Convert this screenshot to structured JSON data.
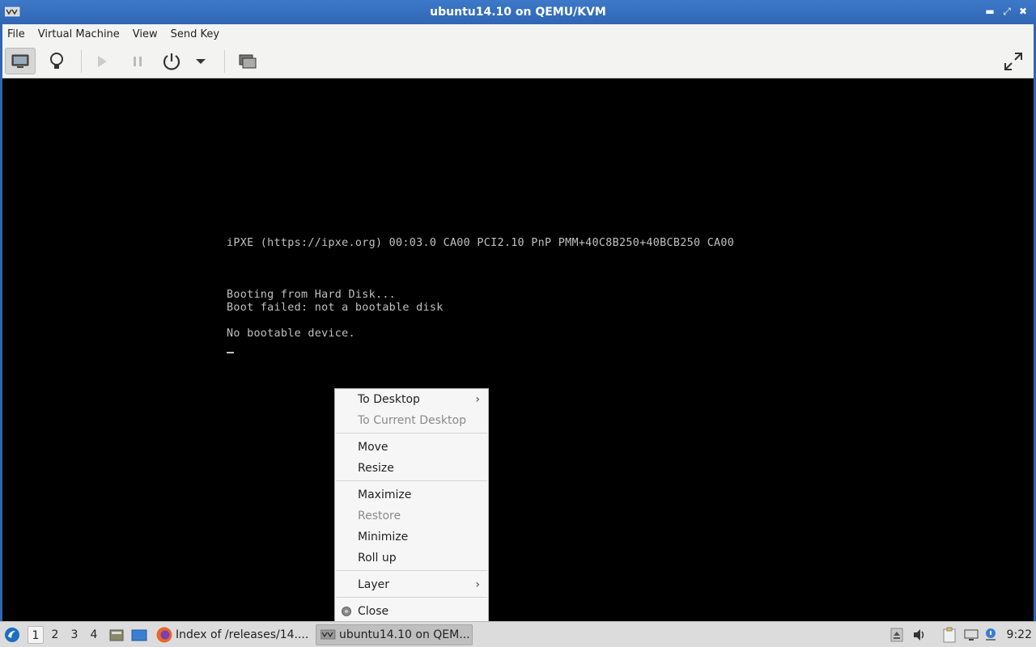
{
  "window": {
    "title": "ubuntu14.10 on QEMU/KVM",
    "controls": [
      "minimize-icon",
      "restore-icon",
      "close-icon"
    ]
  },
  "menubar": {
    "items": [
      "File",
      "Virtual Machine",
      "View",
      "Send Key"
    ]
  },
  "toolbar": {
    "buttons": [
      "console-icon",
      "lightbulb-icon",
      "play-icon",
      "pause-icon",
      "power-icon",
      "chevron-down-icon",
      "screenshot-icon",
      "fullscreen-icon"
    ]
  },
  "console": {
    "line1": "iPXE (https://ipxe.org) 00:03.0 CA00 PCI2.10 PnP PMM+40C8B250+40BCB250 CA00",
    "line2": "Booting from Hard Disk...",
    "line3": "Boot failed: not a bootable disk",
    "line4": "No bootable device."
  },
  "context_menu": {
    "items": [
      {
        "label": "To Desktop",
        "submenu": true,
        "enabled": true
      },
      {
        "label": "To Current Desktop",
        "enabled": false
      },
      {
        "label": "Move",
        "enabled": true
      },
      {
        "label": "Resize",
        "enabled": true
      },
      {
        "label": "Maximize",
        "enabled": true
      },
      {
        "label": "Restore",
        "enabled": false
      },
      {
        "label": "Minimize",
        "enabled": true
      },
      {
        "label": "Roll up",
        "enabled": true
      },
      {
        "label": "Layer",
        "submenu": true,
        "enabled": true
      },
      {
        "label": "Close",
        "enabled": true,
        "icon": "close-radio-icon"
      }
    ]
  },
  "taskbar": {
    "desktops": [
      "1",
      "2",
      "3",
      "4"
    ],
    "active_desktop": "1",
    "tasks": [
      {
        "label": "Index of /releases/14....",
        "icon": "firefox-icon"
      },
      {
        "label": "ubuntu14.10 on QEM...",
        "icon": "virt-manager-icon",
        "active": true
      }
    ],
    "clock": "9:22"
  },
  "colors": {
    "titlebar": "#3070bd",
    "console_text": "#c0c0c0",
    "console_bg": "#000000"
  }
}
